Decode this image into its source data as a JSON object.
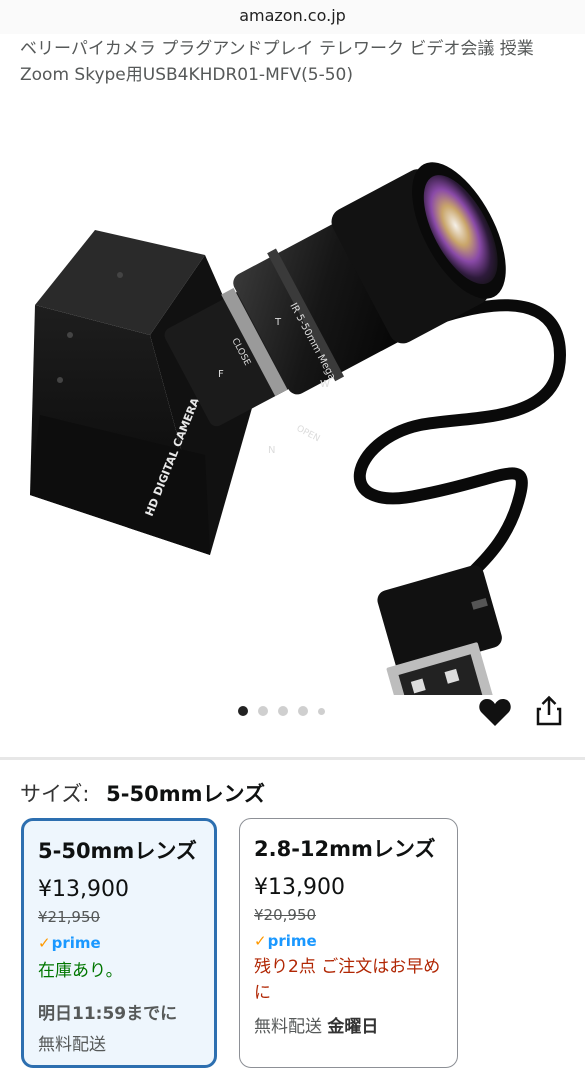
{
  "browser": {
    "url": "amazon.co.jp"
  },
  "product": {
    "title": "ベリーパイカメラ プラグアンドプレイ テレワーク ビデオ会議 授業 Zoom Skype用USB4KHDR01-MFV(5-50)"
  },
  "camera_image": {
    "body_text": "HD DIGITAL CAMERA",
    "lens_text": "IR 5-50mm Mega",
    "lens_marks": [
      "T",
      "W",
      "CLOSE",
      "F",
      "N",
      "OPEN"
    ]
  },
  "gallery": {
    "image_count": 5,
    "active_index": 0
  },
  "icons": {
    "favorite": "heart-icon",
    "share": "share-icon"
  },
  "size_selector": {
    "label": "サイズ:",
    "selected_value": "5-50mmレンズ"
  },
  "options": [
    {
      "name": "5-50mmレンズ",
      "price": "¥13,900",
      "list_price": "¥21,950",
      "prime": "prime",
      "stock": "在庫あり。",
      "delivery_bold": "明日11:59までに",
      "delivery_note": "無料配送"
    },
    {
      "name": "2.8-12mmレンズ",
      "price": "¥13,900",
      "list_price": "¥20,950",
      "prime": "prime",
      "stock": "残り2点 ご注文はお早めに",
      "delivery_note": "無料配送",
      "delivery_day": "金曜日"
    }
  ],
  "colors": {
    "selected_border": "#2d6fb0",
    "selected_bg": "#eef6fd",
    "prime_blue": "#1a98ff",
    "in_stock_green": "#007600",
    "low_stock_red": "#b12704"
  }
}
